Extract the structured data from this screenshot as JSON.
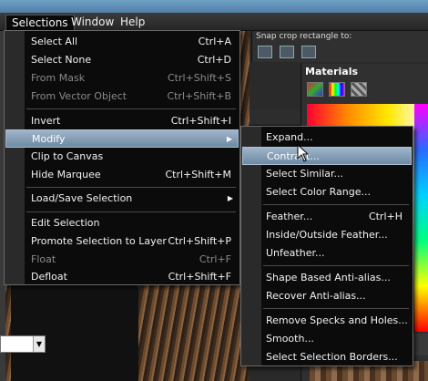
{
  "menubar": {
    "items": [
      {
        "label": "Selections",
        "active": true
      },
      {
        "label": "Window",
        "active": false
      },
      {
        "label": "Help",
        "active": false
      }
    ]
  },
  "toolbar": {
    "label": "Snap crop rectangle to:"
  },
  "palette": {
    "title": "Materials"
  },
  "selections_menu": {
    "items": [
      {
        "label": "Select All",
        "shortcut": "Ctrl+A",
        "disabled": false
      },
      {
        "label": "Select None",
        "shortcut": "Ctrl+D",
        "disabled": false
      },
      {
        "label": "From Mask",
        "shortcut": "Ctrl+Shift+S",
        "disabled": true
      },
      {
        "label": "From Vector Object",
        "shortcut": "Ctrl+Shift+B",
        "disabled": true
      },
      {
        "label": "Invert",
        "shortcut": "Ctrl+Shift+I",
        "disabled": false
      },
      {
        "label": "Modify",
        "shortcut": "",
        "disabled": false,
        "submenu": true,
        "highlighted": true
      },
      {
        "label": "Clip to Canvas",
        "shortcut": "",
        "disabled": false
      },
      {
        "label": "Hide Marquee",
        "shortcut": "Ctrl+Shift+M",
        "disabled": false
      },
      {
        "label": "Load/Save Selection",
        "shortcut": "",
        "disabled": false,
        "submenu": true
      },
      {
        "label": "Edit Selection",
        "shortcut": "",
        "disabled": false
      },
      {
        "label": "Promote Selection to Layer",
        "shortcut": "Ctrl+Shift+P",
        "disabled": false
      },
      {
        "label": "Float",
        "shortcut": "Ctrl+F",
        "disabled": true
      },
      {
        "label": "Defloat",
        "shortcut": "Ctrl+Shift+F",
        "disabled": false
      }
    ]
  },
  "modify_menu": {
    "items": [
      {
        "label": "Expand...",
        "shortcut": ""
      },
      {
        "label": "Contract...",
        "shortcut": "",
        "highlighted": true
      },
      {
        "label": "Select Similar...",
        "shortcut": ""
      },
      {
        "label": "Select Color Range...",
        "shortcut": ""
      },
      {
        "label": "Feather...",
        "shortcut": "Ctrl+H"
      },
      {
        "label": "Inside/Outside Feather...",
        "shortcut": ""
      },
      {
        "label": "Unfeather...",
        "shortcut": ""
      },
      {
        "label": "Shape Based Anti-alias...",
        "shortcut": ""
      },
      {
        "label": "Recover Anti-alias...",
        "shortcut": ""
      },
      {
        "label": "Remove Specks and Holes...",
        "shortcut": ""
      },
      {
        "label": "Smooth...",
        "shortcut": ""
      },
      {
        "label": "Select Selection Borders...",
        "shortcut": ""
      }
    ]
  },
  "icons": {
    "submenu_arrow": "chevron-right-icon",
    "dropdown_arrow": "chevron-down-icon",
    "cursor": "mouse-pointer-icon"
  },
  "colors": {
    "highlight": "#7f99b3",
    "menu_bg": "#0b0b0b",
    "disabled_text": "#8a8a8a"
  }
}
